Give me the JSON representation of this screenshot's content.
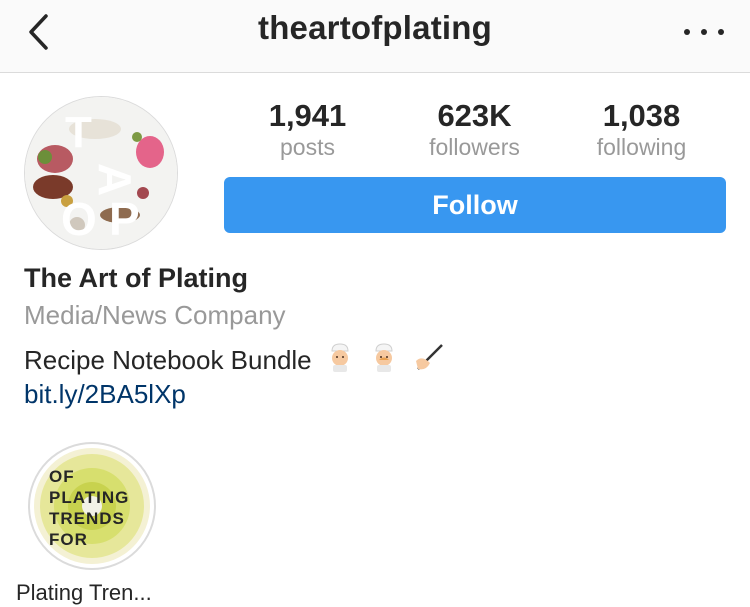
{
  "header": {
    "username": "theartofplating",
    "back_icon": "chevron-left-icon",
    "more_icon": "more-horizontal-icon"
  },
  "stats": [
    {
      "value": "1,941",
      "label": "posts"
    },
    {
      "value": "623K",
      "label": "followers"
    },
    {
      "value": "1,038",
      "label": "following"
    }
  ],
  "follow_button": {
    "label": "Follow",
    "color": "#3897f0"
  },
  "profile": {
    "name": "The Art of Plating",
    "category": "Media/News Company",
    "bio": "Recipe Notebook Bundle",
    "bio_emojis": [
      "cook-emoji",
      "cook-emoji",
      "writing-hand-emoji"
    ],
    "link": "bit.ly/2BA5lXp",
    "avatar_logo": "TAOP"
  },
  "highlight": {
    "label": "Plating Tren...",
    "cover_text": [
      "OF",
      "PLATING",
      "TRENDS",
      "FOR"
    ]
  },
  "colors": {
    "link": "#003569",
    "muted": "#999999",
    "text": "#262626"
  }
}
